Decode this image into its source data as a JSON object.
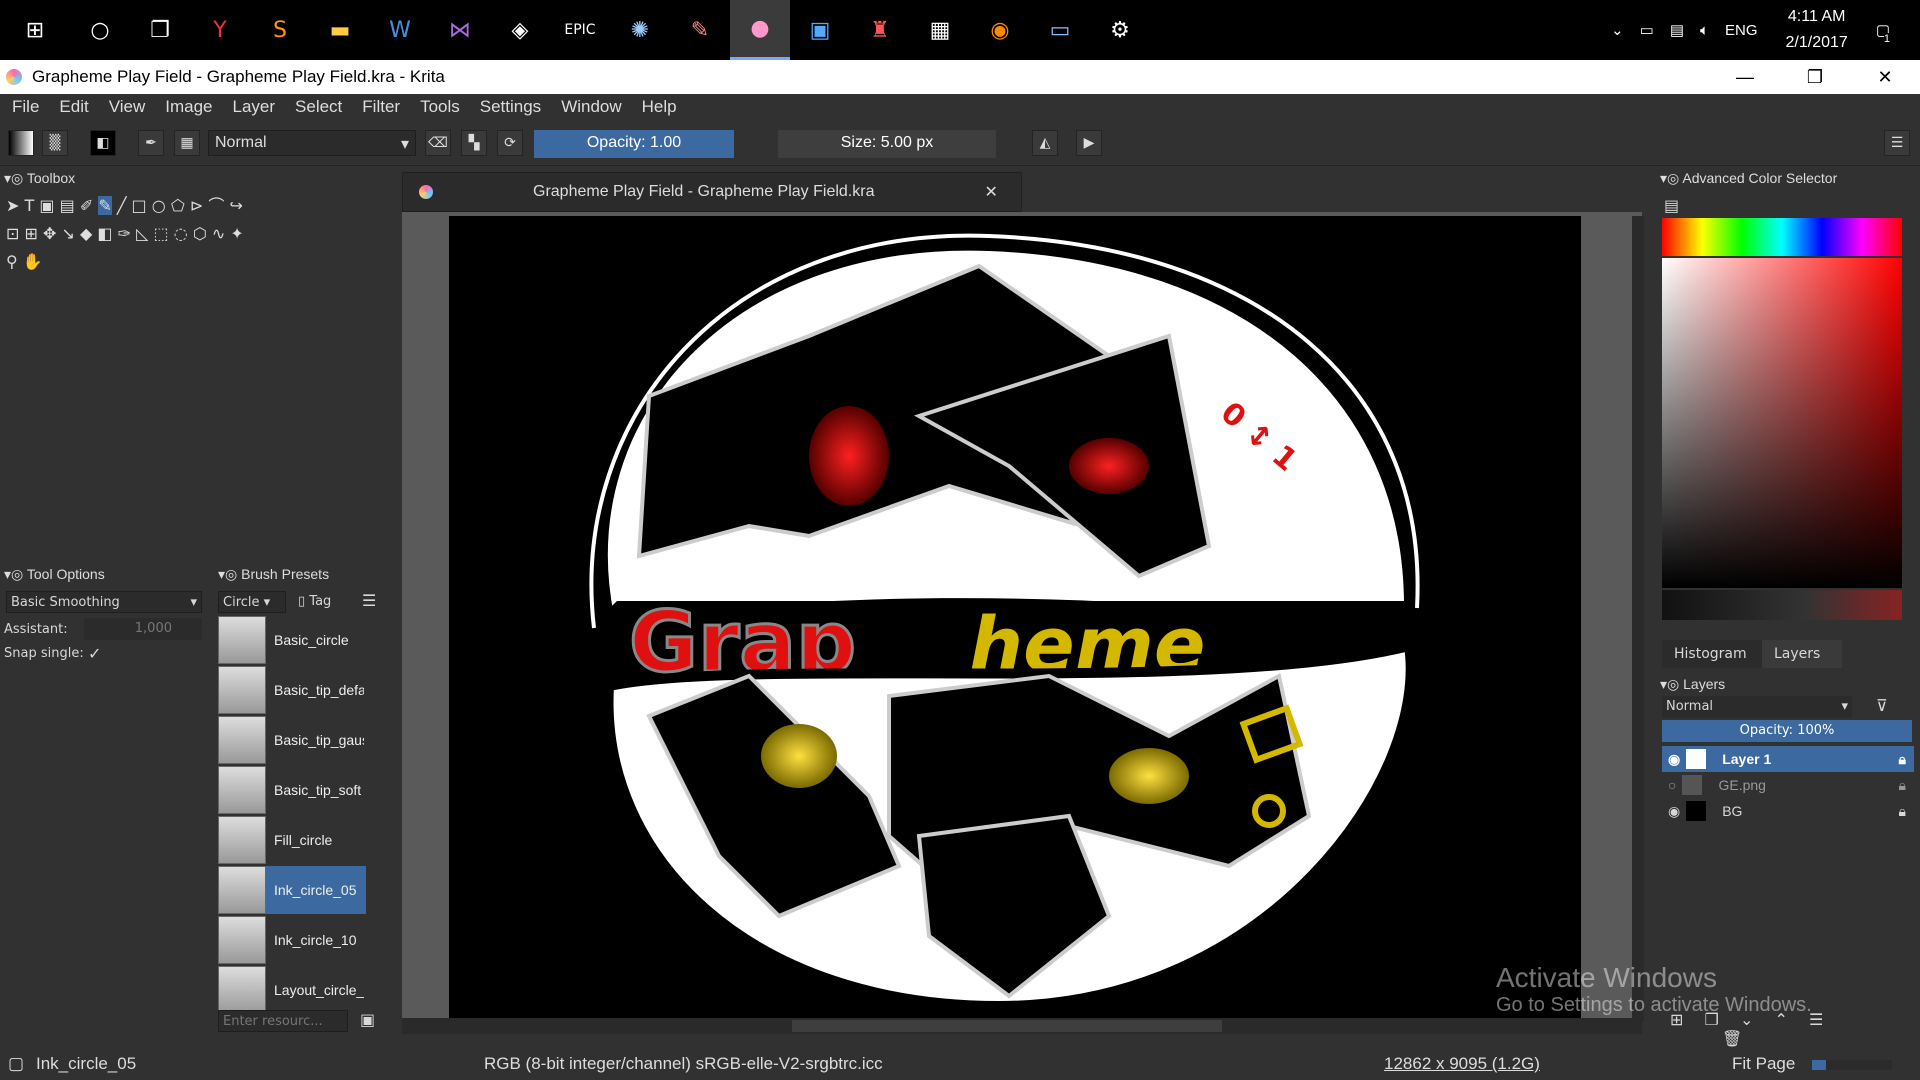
{
  "taskbar": {
    "apps": [
      "start-icon",
      "cortana-icon",
      "task-view-icon",
      "yandex-icon",
      "sublime-icon",
      "explorer-icon",
      "word-icon",
      "visual-studio-icon",
      "unity-icon",
      "epic-games-icon",
      "pycharm-icon",
      "paint-icon",
      "krita-icon",
      "store-icon",
      "popcorn-icon",
      "movie-maker-icon",
      "blender-icon",
      "monitor-icon",
      "settings-icon"
    ],
    "language": "ENG",
    "time": "4:11 AM",
    "date": "2/1/2017",
    "notification_count": "1"
  },
  "window": {
    "title": "Grapheme Play Field - Grapheme Play Field.kra  - Krita"
  },
  "menu": [
    "File",
    "Edit",
    "View",
    "Image",
    "Layer",
    "Select",
    "Filter",
    "Tools",
    "Settings",
    "Window",
    "Help"
  ],
  "toolbar": {
    "blend_mode": "Normal",
    "opacity_label": "Opacity:  1.00",
    "size_label": "Size:  5.00 px"
  },
  "toolbox": {
    "title": "Toolbox"
  },
  "tool_options": {
    "title": "Tool Options",
    "smoothing": "Basic Smoothing",
    "assistant_label": "Assistant:",
    "assistant_value": "1,000",
    "snap_label": "Snap single:"
  },
  "brush_presets": {
    "title": "Brush Presets",
    "filter": "Circle",
    "tag_label": "Tag",
    "search_placeholder": "Enter resourc...",
    "items": [
      "Basic_circle",
      "Basic_tip_default",
      "Basic_tip_gaussian",
      "Basic_tip_soft",
      "Fill_circle",
      "Ink_circle_05",
      "Ink_circle_10",
      "Layout_circle_s"
    ],
    "selected_index": 5
  },
  "document": {
    "tab_title": "Grapheme Play Field - Grapheme Play Field.kra",
    "logo_text_left": "Grap",
    "logo_text_right": "heme"
  },
  "color_selector": {
    "title": "Advanced Color Selector"
  },
  "layers_panel": {
    "tabs": [
      "Histogram",
      "Layers"
    ],
    "active_tab": "Layers",
    "title": "Layers",
    "blend_mode": "Normal",
    "opacity_label": "Opacity:  100%",
    "layers": [
      {
        "name": "Layer 1",
        "selected": true
      },
      {
        "name": "GE.png",
        "selected": false
      },
      {
        "name": "BG",
        "selected": false
      }
    ]
  },
  "statusbar": {
    "brush_name": "Ink_circle_05",
    "color_profile": "RGB (8-bit integer/channel)  sRGB-elle-V2-srgbtrc.icc",
    "dimensions": "12862 x 9095 (1.2G)",
    "zoom_mode": "Fit Page"
  },
  "watermark": {
    "title": "Activate Windows",
    "subtitle": "Go to Settings to activate Windows."
  },
  "colors": {
    "accent": "#3c6aa0",
    "panel_bg": "#313131",
    "logo_red": "#e01010",
    "logo_yellow": "#d4b800"
  }
}
